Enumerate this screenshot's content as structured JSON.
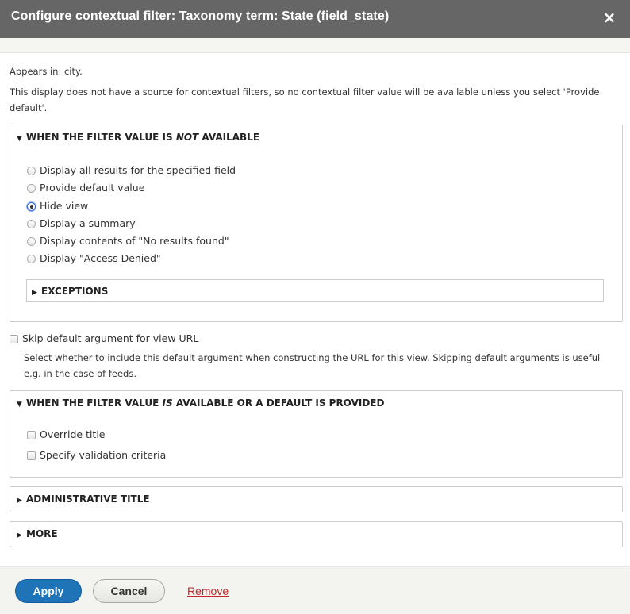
{
  "dialog": {
    "title": "Configure contextual filter: Taxonomy term: State (field_state)",
    "close_icon": "×"
  },
  "info": {
    "appears_in": "Appears in: city.",
    "notice": "This display does not have a source for contextual filters, so no contextual filter value will be available unless you select 'Provide default'."
  },
  "not_available": {
    "legend_prefix": "WHEN THE FILTER VALUE IS ",
    "legend_em": "NOT",
    "legend_suffix": " AVAILABLE",
    "options": [
      {
        "label": "Display all results for the specified field",
        "checked": false
      },
      {
        "label": "Provide default value",
        "checked": false
      },
      {
        "label": "Hide view",
        "checked": true
      },
      {
        "label": "Display a summary",
        "checked": false
      },
      {
        "label": "Display contents of \"No results found\"",
        "checked": false
      },
      {
        "label": "Display \"Access Denied\"",
        "checked": false
      }
    ],
    "exceptions_label": "EXCEPTIONS"
  },
  "skip_default": {
    "label": "Skip default argument for view URL",
    "checked": false,
    "help": "Select whether to include this default argument when constructing the URL for this view. Skipping default arguments is useful e.g. in the case of feeds."
  },
  "is_available": {
    "legend_prefix": "WHEN THE FILTER VALUE ",
    "legend_em": "IS",
    "legend_suffix": " AVAILABLE OR A DEFAULT IS PROVIDED",
    "options": [
      {
        "label": "Override title",
        "checked": false
      },
      {
        "label": "Specify validation criteria",
        "checked": false
      }
    ]
  },
  "admin_title": {
    "label": "ADMINISTRATIVE TITLE"
  },
  "more": {
    "label": "MORE"
  },
  "footer": {
    "apply_label": "Apply",
    "cancel_label": "Cancel",
    "remove_label": "Remove"
  },
  "colors": {
    "titlebar": "#666666",
    "apply": "#1f73b7",
    "remove_link": "#c1272d"
  }
}
